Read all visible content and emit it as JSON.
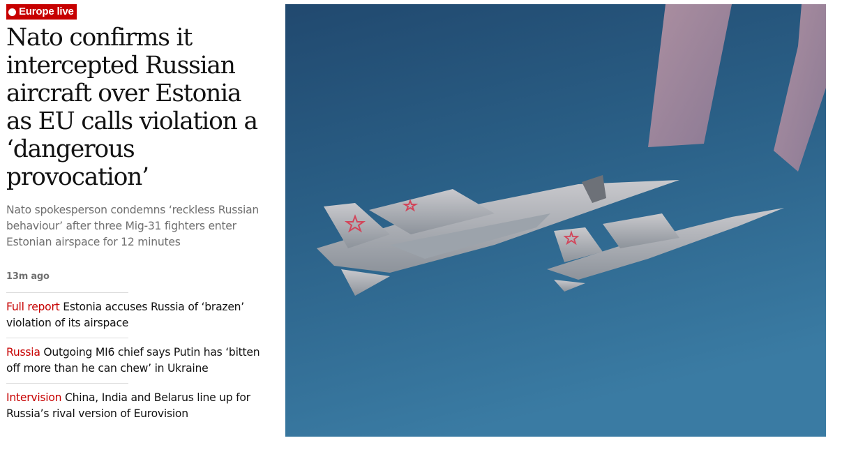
{
  "kicker": {
    "label": "Europe live",
    "color": "#c70000"
  },
  "headline": "Nato confirms it intercepted Russian aircraft over Estonia as EU calls violation a ‘dangerous provocation’",
  "standfirst": "Nato spokesperson condemns ‘reckless Russian behaviour’ after three Mig-31 fighters enter Estonian airspace for 12 minutes",
  "timestamp": "13m ago",
  "related_links": [
    {
      "kicker": "Full report",
      "text": "Estonia accuses Russia of ‘brazen’ violation of its airspace"
    },
    {
      "kicker": "Russia",
      "text": "Outgoing MI6 chief says Putin has ‘bitten off more than he can chew’ in Ukraine"
    },
    {
      "kicker": "Intervision",
      "text": "China, India and Belarus line up for Russia’s rival version of Eurovision"
    }
  ],
  "hero_image": {
    "subject": "two-fighter-jets-in-flight",
    "sky_color": "#2a5f86"
  }
}
